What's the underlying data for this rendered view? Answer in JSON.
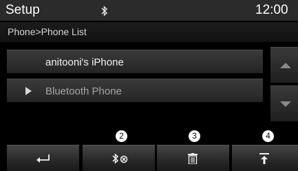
{
  "header": {
    "title": "Setup",
    "clock": "12:00"
  },
  "breadcrumb": "Phone>Phone List",
  "devices": [
    {
      "label": "anitooni's iPhone",
      "selected": false
    },
    {
      "label": "Bluetooth Phone",
      "selected": true
    }
  ],
  "callouts": {
    "n2": "2",
    "n3": "3",
    "n4": "4"
  },
  "icons": {
    "status": "bluetooth-icon",
    "back": "back-arrow-icon",
    "disconnect": "bluetooth-disconnect-icon",
    "delete": "trash-icon",
    "top": "move-to-top-icon"
  },
  "colors": {
    "background": "#000000",
    "text": "#ffffff",
    "dim_text": "#a6a6a6"
  }
}
